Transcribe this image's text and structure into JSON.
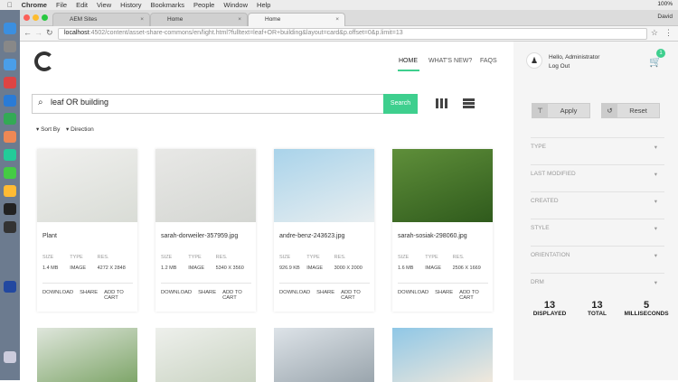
{
  "menubar": {
    "app": "Chrome",
    "items": [
      "File",
      "Edit",
      "View",
      "History",
      "Bookmarks",
      "People",
      "Window",
      "Help"
    ],
    "status": "100%",
    "user": "David"
  },
  "tabs": [
    {
      "label": "AEM Sites"
    },
    {
      "label": "Home"
    },
    {
      "label": "Home",
      "active": true
    }
  ],
  "address": {
    "host": "localhost",
    "path": ":4502/content/asset-share-commons/en/light.html?fulltext=leaf+OR+building&layout=card&p.offset=0&p.limit=13"
  },
  "nav": {
    "home": "HOME",
    "whats_new": "WHAT'S NEW?",
    "faqs": "FAQS"
  },
  "search": {
    "value": "leaf OR building",
    "button": "Search"
  },
  "sort": {
    "sort_by": "Sort By",
    "direction": "Direction"
  },
  "cards": [
    {
      "title": "Plant",
      "size": "1.4 MB",
      "type": "IMAGE",
      "res": "4272 X 2848",
      "colors": [
        "#f0f0ee",
        "#d9dcd6"
      ]
    },
    {
      "title": "sarah-dorweiler-357959.jpg",
      "size": "1.2 MB",
      "type": "IMAGE",
      "res": "5340 X 3560",
      "colors": [
        "#e8e8e6",
        "#d4d6d2"
      ]
    },
    {
      "title": "andre-benz-243623.jpg",
      "size": "926.9 KB",
      "type": "IMAGE",
      "res": "3000 X 2000",
      "colors": [
        "#a9d3ea",
        "#e8eef0"
      ]
    },
    {
      "title": "sarah-sosiak-298060.jpg",
      "size": "1.6 MB",
      "type": "IMAGE",
      "res": "2506 X 1669",
      "colors": [
        "#5f8f3a",
        "#2f5a1c"
      ]
    }
  ],
  "card_labels": {
    "size": "SIZE",
    "type": "TYPE",
    "res": "RES.",
    "download": "DOWNLOAD",
    "share": "SHARE",
    "add_to_cart": "ADD TO CART"
  },
  "user": {
    "greeting": "Hello, Administrator",
    "logout": "Log Out",
    "cart_count": "1"
  },
  "filters": {
    "apply": "Apply",
    "reset": "Reset",
    "facets": [
      "TYPE",
      "LAST MODIFIED",
      "CREATED",
      "STYLE",
      "ORIENTATION",
      "DRM"
    ]
  },
  "stats": [
    {
      "value": "13",
      "label": "DISPLAYED"
    },
    {
      "value": "13",
      "label": "TOTAL"
    },
    {
      "value": "5",
      "label": "MILLISECONDS"
    }
  ],
  "accent": "#3ecf8e"
}
